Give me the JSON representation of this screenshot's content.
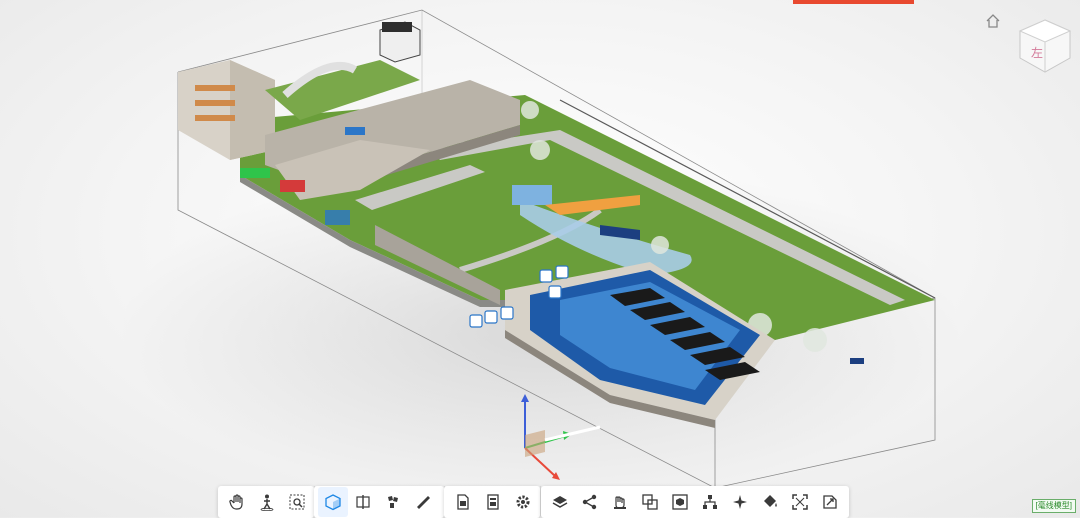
{
  "viewer": {
    "model_label": "[毫线模型]",
    "viewcube_label": "左"
  },
  "toolbar_groups": [
    {
      "tools": [
        {
          "icon": "hand-pan-icon"
        },
        {
          "icon": "person-walk-icon"
        },
        {
          "icon": "zoom-box-icon"
        }
      ]
    },
    {
      "tools": [
        {
          "icon": "section-box-icon",
          "active": true
        },
        {
          "icon": "section-plane-icon"
        },
        {
          "icon": "explode-icon"
        },
        {
          "icon": "measure-ruler-icon"
        }
      ]
    },
    {
      "tools": [
        {
          "icon": "properties-doc-icon"
        },
        {
          "icon": "data-panel-icon"
        },
        {
          "icon": "settings-gear-icon"
        }
      ]
    },
    {
      "tools": [
        {
          "icon": "layers-icon"
        },
        {
          "icon": "share-icon"
        },
        {
          "icon": "hand-pick-icon"
        },
        {
          "icon": "overlap-icon"
        },
        {
          "icon": "isolate-icon"
        },
        {
          "icon": "tree-icon"
        },
        {
          "icon": "sparkle-icon"
        },
        {
          "icon": "paint-bucket-icon"
        },
        {
          "icon": "fullscreen-icon"
        },
        {
          "icon": "snapshot-icon"
        }
      ]
    }
  ],
  "colors": {
    "accent": "#e8492f",
    "grass": "#6a9e3a",
    "water_blue": "#2b76c8",
    "tool_icon": "#3a3a3a",
    "active_tool": "#1e88e5"
  }
}
